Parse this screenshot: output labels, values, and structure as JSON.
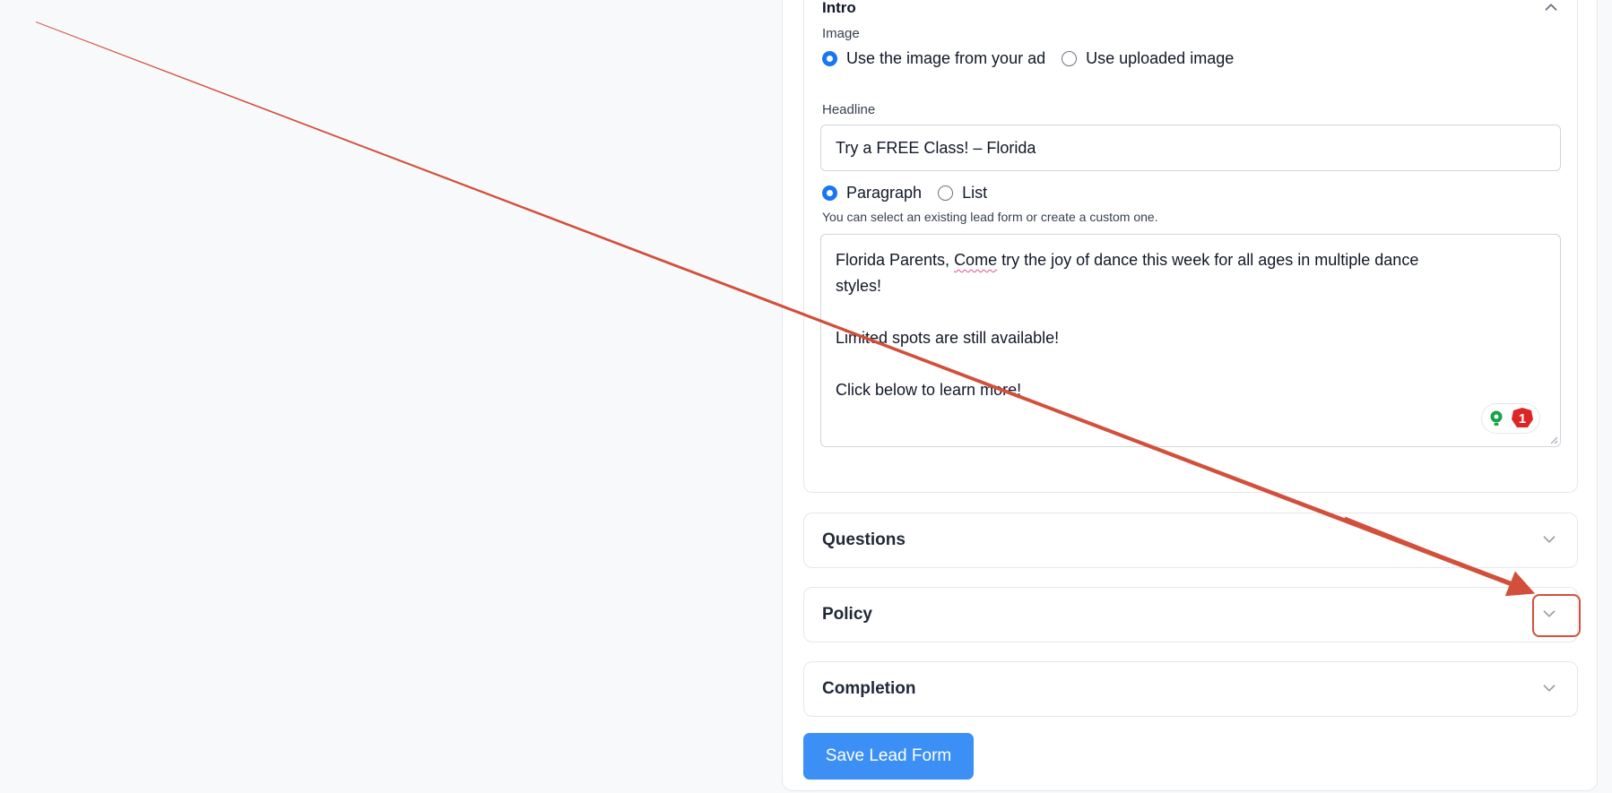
{
  "intro": {
    "title": "Intro",
    "image_label": "Image",
    "image_options": [
      {
        "label": "Use the image from your ad",
        "checked": true
      },
      {
        "label": "Use uploaded image",
        "checked": false
      }
    ],
    "headline_label": "Headline",
    "headline_value": "Try a FREE Class! – Florida",
    "format_options": [
      {
        "label": "Paragraph",
        "checked": true
      },
      {
        "label": "List",
        "checked": false
      }
    ],
    "helper_text": "You can select an existing lead form or create a custom one.",
    "body": {
      "line1_pre": "Florida Parents, ",
      "line1_misspelled": "Come",
      "line1_post": " try the joy of dance this week for all ages in multiple dance",
      "line2": "styles!",
      "line3": "Limited spots are still available!",
      "line4": "Click below to learn more!"
    },
    "grammar_badge_count": "1"
  },
  "sections": {
    "questions": "Questions",
    "policy": "Policy",
    "completion": "Completion"
  },
  "save_button_label": "Save Lead Form",
  "colors": {
    "accent": "#1877f2",
    "button": "#3b8ff5",
    "annotation": "#d2503b"
  }
}
